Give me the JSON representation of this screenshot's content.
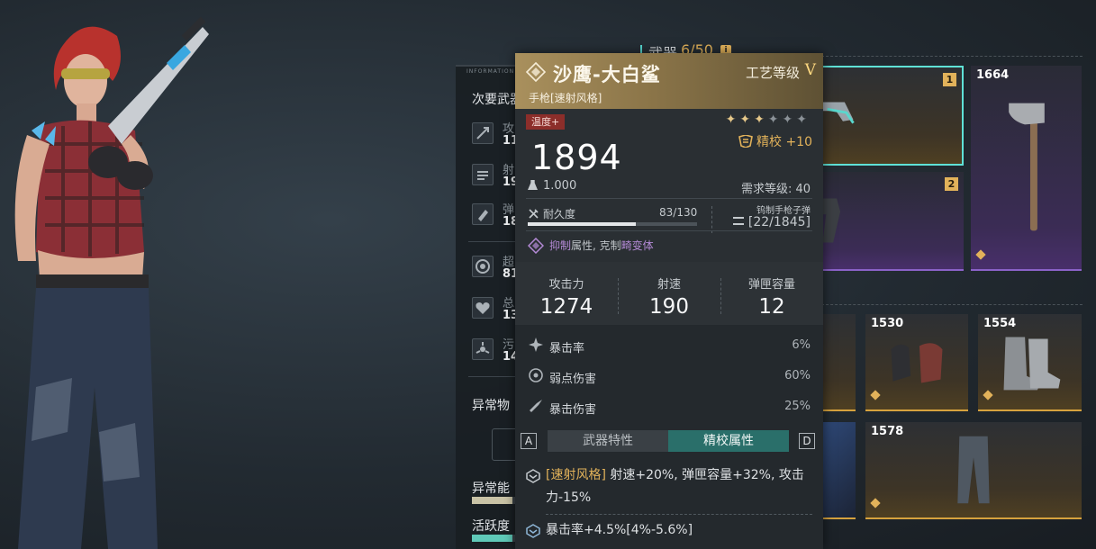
{
  "stats_panel": {
    "tag": "INFORMATION",
    "section_title": "次要武器",
    "stats": [
      {
        "icon": "attack-icon",
        "label": "攻",
        "value": "11"
      },
      {
        "icon": "fire-rate-icon",
        "label": "射",
        "value": "19"
      },
      {
        "icon": "magazine-icon",
        "label": "弹",
        "value": "18"
      },
      {
        "icon": "super-icon",
        "label": "超",
        "value": "81"
      },
      {
        "icon": "health-icon",
        "label": "总",
        "value": "13"
      },
      {
        "icon": "pollution-icon",
        "label": "污",
        "value": "14"
      }
    ],
    "anomaly_material": "异常物",
    "anomaly_energy": "异常能",
    "activity": "活跃度",
    "anomaly_energy_level": 0.55,
    "activity_level": 0.55
  },
  "inventory": {
    "label": "武器",
    "count": "6/50",
    "info_icon": "i",
    "slots": [
      {
        "id": "slot-1",
        "rank": "1",
        "style": "gold",
        "selected": true
      },
      {
        "id": "slot-axe",
        "number": "1664",
        "style": "purple"
      },
      {
        "id": "slot-2",
        "rank": "2",
        "style": "purple"
      },
      {
        "id": "slot-armor-a",
        "style": "gold"
      },
      {
        "id": "slot-gloves",
        "number": "1530",
        "style": "gold"
      },
      {
        "id": "slot-boots",
        "number": "1554",
        "style": "gold"
      },
      {
        "id": "slot-armor-b",
        "style": "gold"
      },
      {
        "id": "slot-pants",
        "number": "1578",
        "style": "gold"
      }
    ]
  },
  "tooltip": {
    "name": "沙鹰-大白鲨",
    "craft_label": "工艺等级",
    "craft_level": "V",
    "subtitle": "手枪[速射风格]",
    "temp_tag": "温度+",
    "stars_total": 6,
    "stars_filled": 3,
    "refine_label": "精校 +10",
    "power": "1894",
    "weight": "1.000",
    "requirement": "需求等级: 40",
    "durability_label": "耐久度",
    "durability_value": "83/130",
    "durability_current": 83,
    "durability_max": 130,
    "ammo_name": "钨制手枪子弹",
    "ammo_count": "[22/1845]",
    "suppress_highlight1": "抑制",
    "suppress_text1": "属性, 克制",
    "suppress_highlight2": "畸变体",
    "main_stats": [
      {
        "label": "攻击力",
        "value": "1274"
      },
      {
        "label": "射速",
        "value": "190"
      },
      {
        "label": "弹匣容量",
        "value": "12"
      }
    ],
    "sub_stats": [
      {
        "label": "暴击率",
        "value": "6%"
      },
      {
        "label": "弱点伤害",
        "value": "60%"
      },
      {
        "label": "暴击伤害",
        "value": "25%"
      }
    ],
    "tabs": {
      "key_left": "A",
      "key_right": "D",
      "tab1": "武器特性",
      "tab2": "精校属性"
    },
    "perk1_tag": "[速射风格]",
    "perk1_text": " 射速+20%, 弹匣容量+32%, 攻击力-15%",
    "perk2_text": "暴击率+4.5%[4%-5.6%]",
    "colors": {
      "gold": "#e2b25a",
      "teal": "#2a6f6a",
      "purple": "#b48ad6",
      "red_tag": "#8c2e2a"
    }
  }
}
